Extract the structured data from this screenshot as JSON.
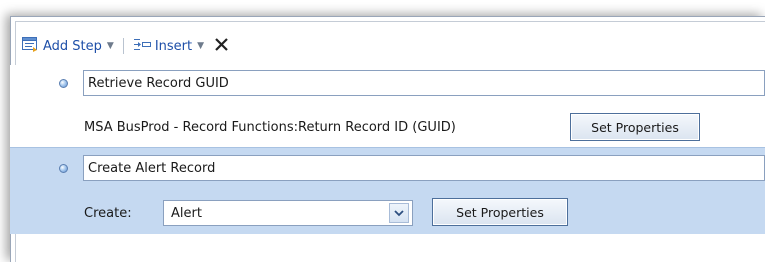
{
  "toolbar": {
    "add_step_label": "Add Step",
    "insert_label": "Insert",
    "add_step_icon": "add-step-icon",
    "insert_icon": "insert-icon",
    "delete_icon": "close-icon",
    "accent_color": "#1e4fa8"
  },
  "steps": [
    {
      "name": "Retrieve Record GUID",
      "description": "MSA BusProd - Record Functions:Return Record ID (GUID)",
      "button_label": "Set Properties"
    },
    {
      "name": "Create Alert Record",
      "create_label": "Create:",
      "create_value": "Alert",
      "button_label": "Set Properties",
      "row_color": "#c5d9f1"
    }
  ]
}
